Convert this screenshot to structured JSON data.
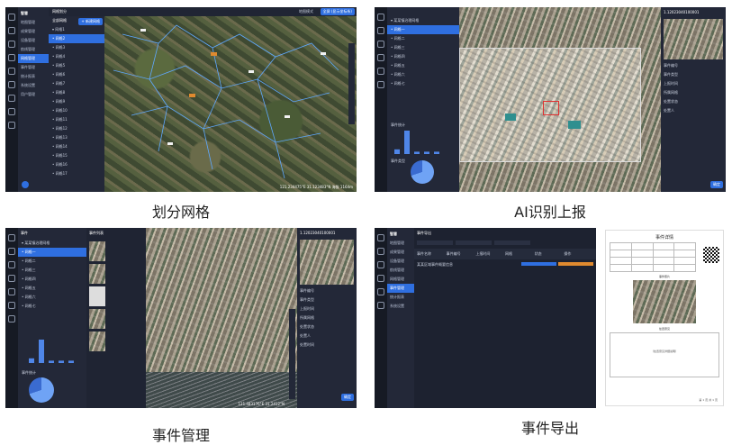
{
  "captions": {
    "grid": "划分网格",
    "ai_report": "AI识别上报",
    "event_mgmt": "事件管理",
    "event_export": "事件导出"
  },
  "panel1": {
    "brand": "智慧",
    "tab": "网格划分",
    "top_buttons": [
      "地图模式",
      "全屏 (显示坐标系)"
    ],
    "menu": [
      "地图管理",
      "成果管理",
      "设备管理",
      "航线管理",
      "网格管理",
      "事件管理",
      "统计报表",
      "系统设置",
      "用户管理"
    ],
    "tree_header": "全部网格",
    "tree_add": "+ 新建网格",
    "tree_items": [
      "网格1",
      "网格2",
      "网格3",
      "网格4",
      "网格5",
      "网格6",
      "网格7",
      "网格8",
      "网格9",
      "网格10",
      "网格11",
      "网格12",
      "网格13",
      "网格14",
      "网格15",
      "网格16",
      "网格17"
    ],
    "status": "121.234475°E  31.123483°N  海拔 1164m"
  },
  "panel2": {
    "title": "1.12023040100001",
    "tree_items": [
      "某某镇治理网格",
      "网格一",
      "网格二",
      "网格三",
      "网格四",
      "网格五",
      "网格六",
      "网格七"
    ],
    "stats_label": "事件统计",
    "bar_values": [
      2,
      10,
      1,
      1,
      1
    ],
    "pie_label": "事件类型",
    "detail_fields": [
      "事件编号",
      "事件类型",
      "上报时间",
      "所属网格",
      "处置状态",
      "处置人"
    ],
    "confirm": "确定"
  },
  "panel3": {
    "header": "事件",
    "list_header": "事件列表",
    "detail_title": "1.12023040100001",
    "fields": [
      "事件编号",
      "事件类型",
      "上报时间",
      "所属网格",
      "处置状态",
      "处置人",
      "处置时间"
    ],
    "bar_values": [
      2,
      10,
      1,
      1,
      1
    ],
    "pie_label": "事件统计",
    "button": "确定",
    "status": "121.483176°E  31.2412°N"
  },
  "panel4": {
    "brand": "智慧",
    "title": "事件导出",
    "columns": [
      "事件名称",
      "事件编号",
      "上报时间",
      "网格",
      "状态",
      "操作"
    ],
    "row": "某某区域事件概要信息",
    "doc_title": "事件详情",
    "doc_section": "事件照片",
    "doc_section2": "处置意见",
    "doc_footer": "第 1 页 共 1 页",
    "doc_note": "（处置意见详细说明）"
  },
  "colors": {
    "accent": "#2f6fe0",
    "dark_bg": "#1d2230",
    "sidebar": "#232838",
    "orange": "#e08a2f"
  }
}
